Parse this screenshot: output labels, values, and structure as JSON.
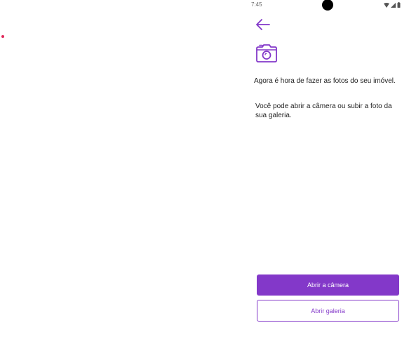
{
  "status_bar": {
    "time": "7:45",
    "icons": [
      "wifi-icon",
      "signal-icon",
      "battery-icon"
    ]
  },
  "header": {
    "back_icon": "arrow-left-icon",
    "illustration_icon": "camera-icon"
  },
  "content": {
    "headline": "Agora é hora de fazer as fotos do seu imóvel.",
    "body": "Você pode abrir a câmera ou subir a foto da sua galeria."
  },
  "actions": {
    "open_camera_label": "Abrir a câmera",
    "open_gallery_label": "Abrir galeria"
  },
  "colors": {
    "accent": "#8338c9",
    "button_text": "#ffffff",
    "marker_dot": "#e0285a"
  }
}
